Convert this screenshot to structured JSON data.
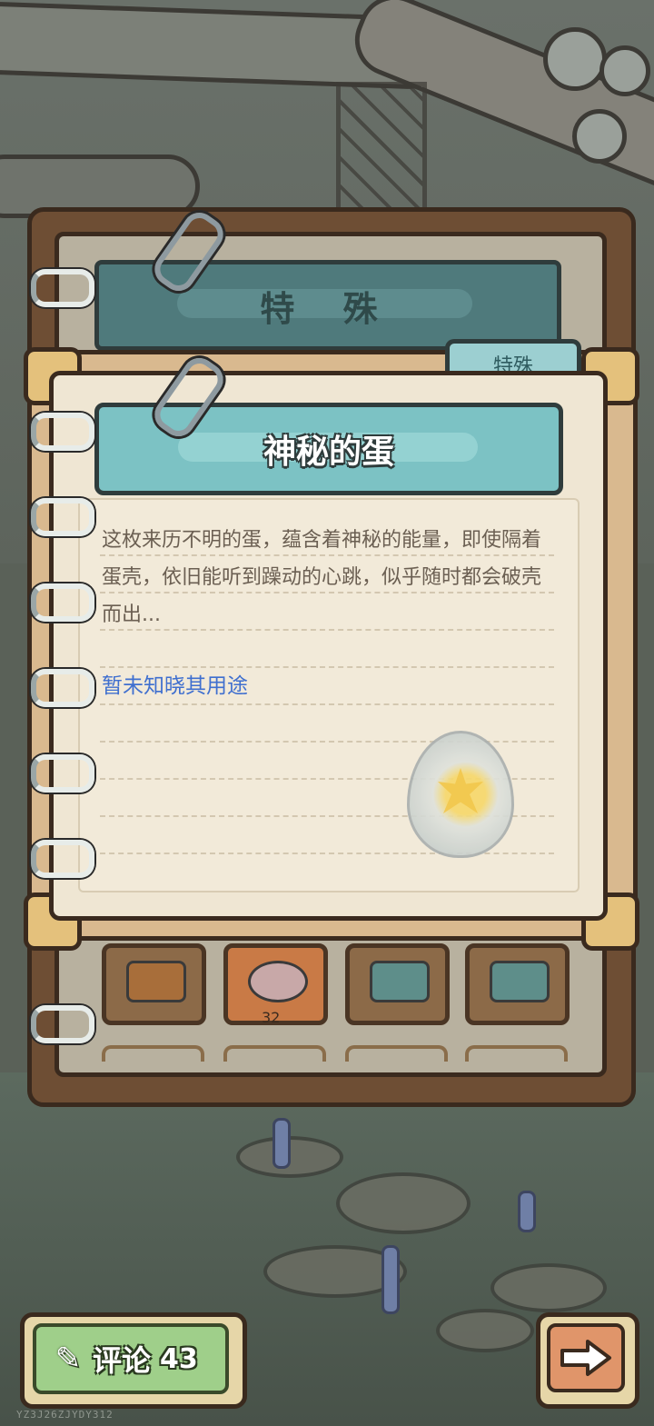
{
  "back_page": {
    "header_title": "特 殊",
    "slot_count": "32"
  },
  "card": {
    "tab_label": "特殊",
    "title": "神秘的蛋",
    "description": "这枚来历不明的蛋，蕴含着神秘的能量，即使隔着蛋壳，依旧能听到躁动的心跳，似乎随时都会破壳而出...",
    "usage_note": "暂未知晓其用途",
    "item_icon": "mystery-egg-icon"
  },
  "bottom_bar": {
    "comment_label": "评论",
    "comment_count": "43",
    "comment_icon": "quill-icon",
    "next_icon": "arrow-right-icon"
  },
  "watermark": "YZ3J26ZJYDY312",
  "colors": {
    "title_banner": "#7cc2c4",
    "usage_text": "#3f6fcf",
    "comment_button": "#9fcf8a",
    "next_button": "#e0956a"
  }
}
